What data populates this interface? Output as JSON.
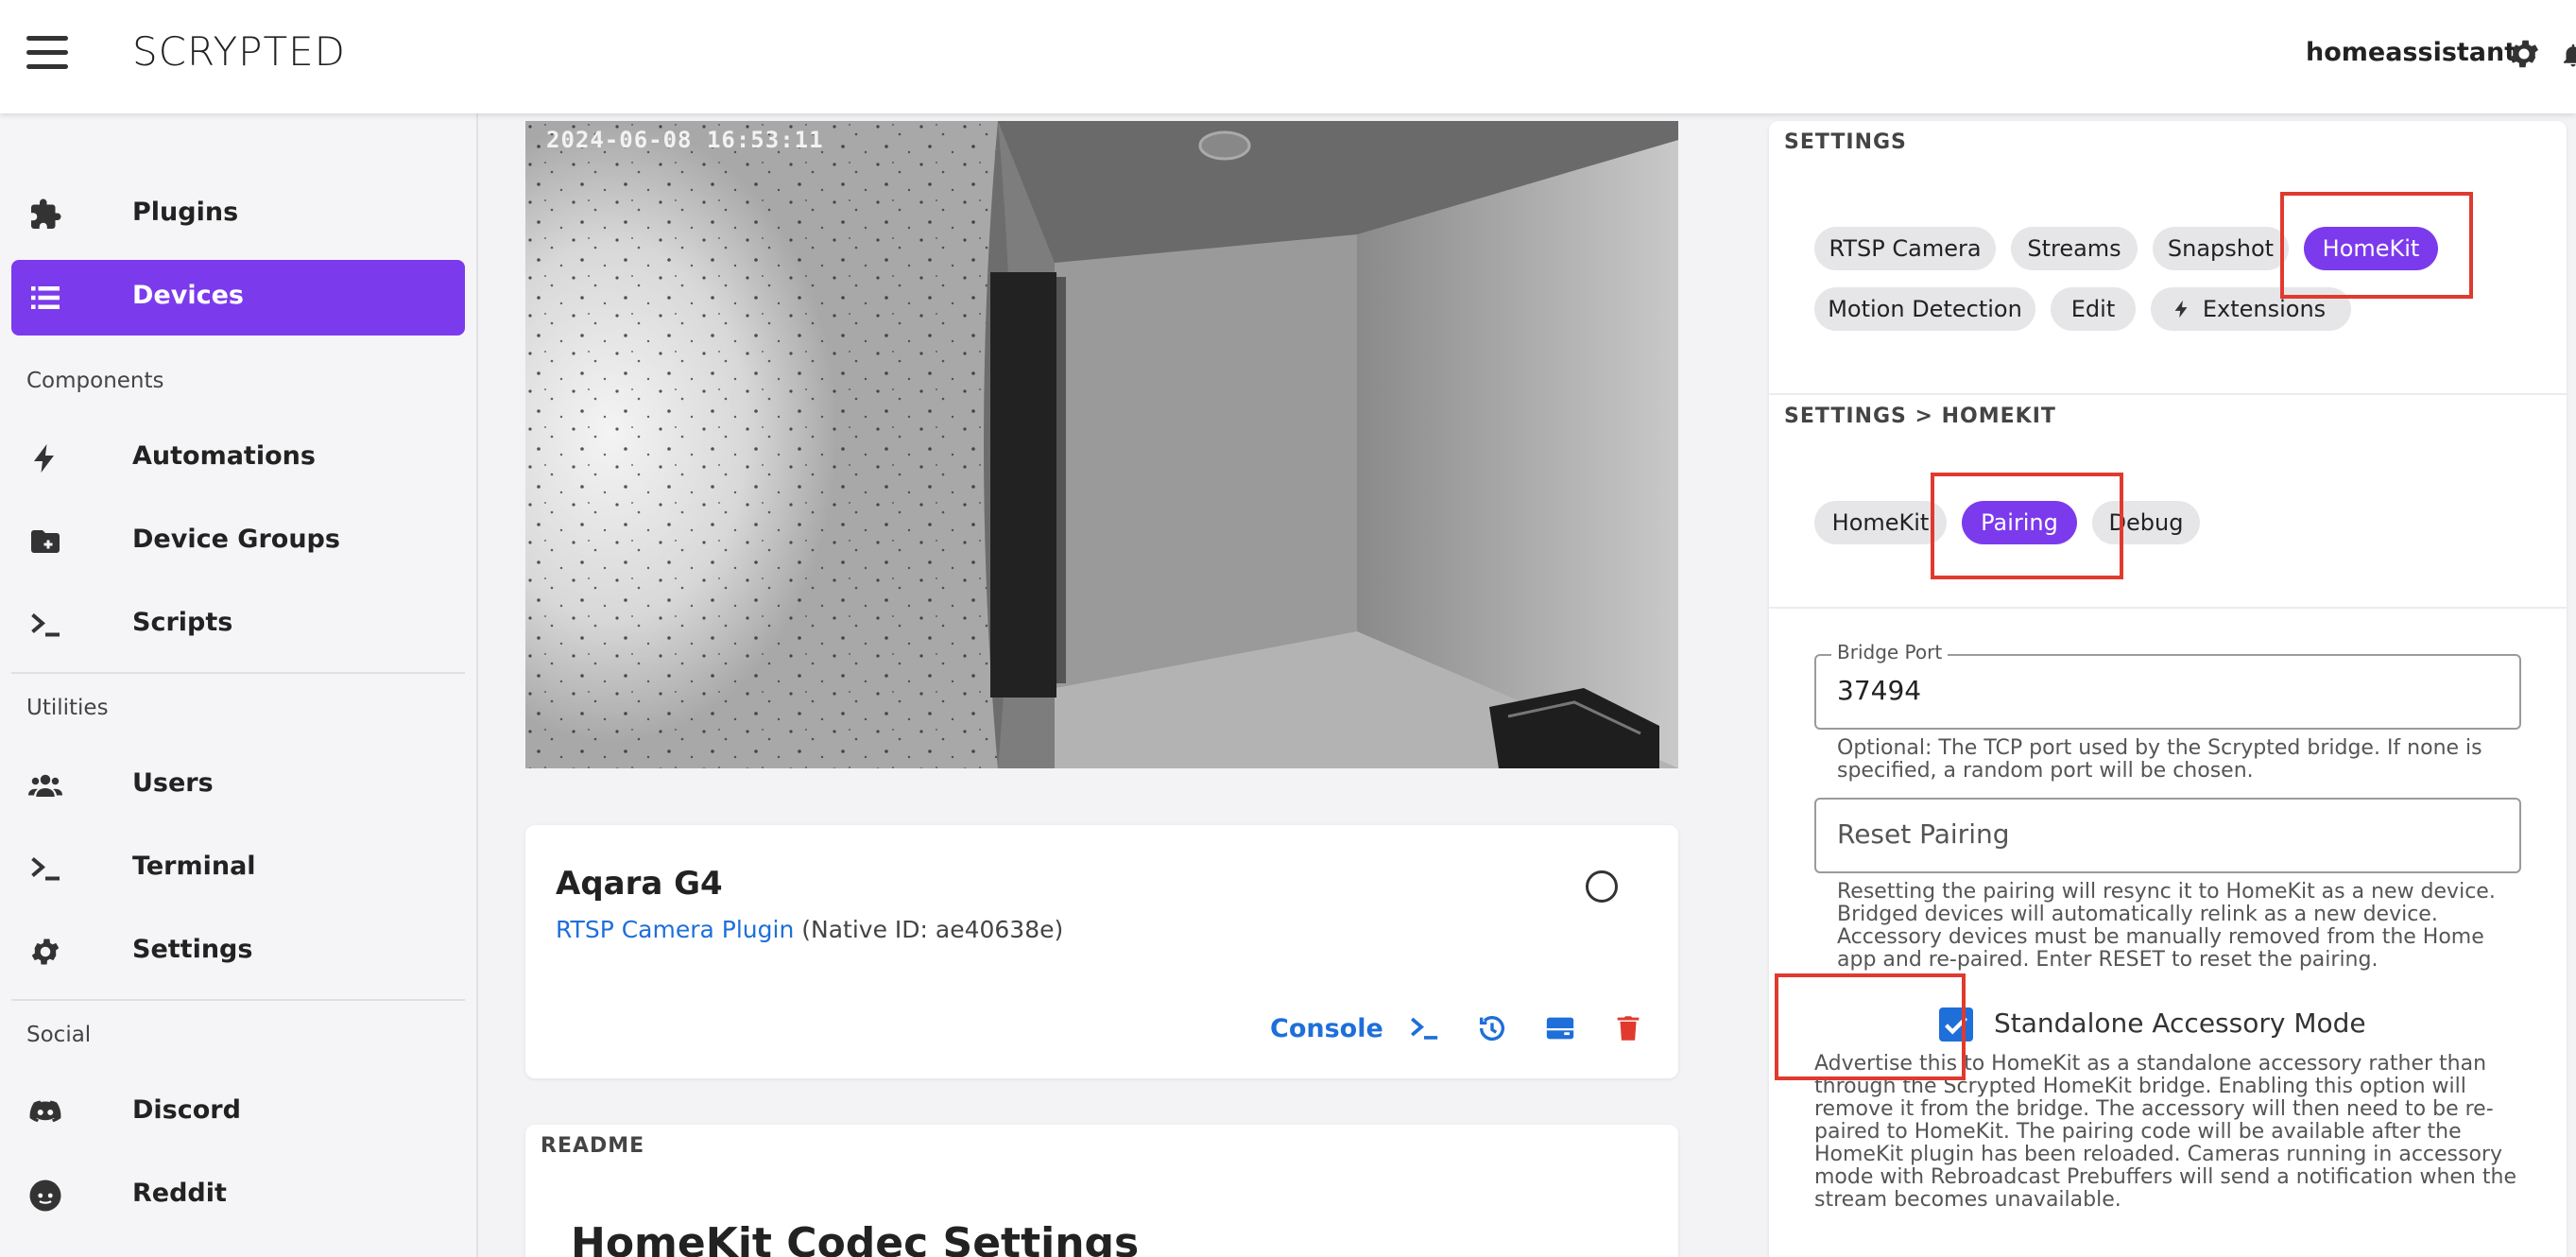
{
  "header": {
    "brand": "SCRYPTED",
    "user": "homeassistant",
    "icons": [
      "menu-icon",
      "gear-icon",
      "bell-icon"
    ]
  },
  "sidebar": {
    "items": [
      {
        "label": "Plugins",
        "icon": "puzzle-icon",
        "active": false
      },
      {
        "label": "Devices",
        "icon": "list-icon",
        "active": true
      }
    ],
    "sections": [
      {
        "title": "Components",
        "items": [
          {
            "label": "Automations",
            "icon": "bolt-icon"
          },
          {
            "label": "Device Groups",
            "icon": "folder-plus-icon"
          },
          {
            "label": "Scripts",
            "icon": "terminal-icon"
          }
        ]
      },
      {
        "title": "Utilities",
        "items": [
          {
            "label": "Users",
            "icon": "users-icon"
          },
          {
            "label": "Terminal",
            "icon": "terminal-icon"
          },
          {
            "label": "Settings",
            "icon": "gear-icon"
          }
        ]
      },
      {
        "title": "Social",
        "items": [
          {
            "label": "Discord",
            "icon": "discord-icon"
          },
          {
            "label": "Reddit",
            "icon": "reddit-icon"
          }
        ]
      }
    ],
    "active_color": "#7c3aed"
  },
  "video": {
    "timestamp": "2024-06-08 16:53:11"
  },
  "device": {
    "name": "Aqara G4",
    "plugin_link": "RTSP Camera Plugin",
    "native_id": "(Native ID: ae40638e)",
    "console_label": "Console",
    "action_icons": [
      "terminal-icon",
      "history-icon",
      "storage-icon",
      "trash-icon"
    ]
  },
  "readme": {
    "label": "README",
    "title": "HomeKit Codec Settings"
  },
  "settings": {
    "label": "SETTINGS",
    "tabs": [
      "RTSP Camera",
      "Streams",
      "Snapshot",
      "HomeKit",
      "Motion Detection",
      "Edit",
      "Extensions"
    ],
    "active_tab": "HomeKit",
    "sub_label": "SETTINGS > HOMEKIT",
    "sub_tabs": [
      "HomeKit",
      "Pairing",
      "Debug"
    ],
    "active_sub_tab": "Pairing",
    "bridge_port": {
      "legend": "Bridge Port",
      "value": "37494",
      "help": "Optional: The TCP port used by the Scrypted bridge. If none is specified, a random port will be chosen."
    },
    "reset_pairing": {
      "placeholder": "Reset Pairing",
      "help": "Resetting the pairing will resync it to HomeKit as a new device. Bridged devices will automatically relink as a new device. Accessory devices must be manually removed from the Home app and re-paired. Enter RESET to reset the pairing."
    },
    "standalone": {
      "label": "Standalone Accessory Mode",
      "checked": true,
      "help": "Advertise this to HomeKit as a standalone accessory rather than through the Scrypted HomeKit bridge. Enabling this option will remove it from the bridge. The accessory will then need to be re-paired to HomeKit. The pairing code will be available after the HomeKit plugin has been reloaded. Cameras running in accessory mode with Rebroadcast Prebuffers will send a notification when the stream becomes unavailable."
    }
  },
  "colors": {
    "accent": "#7c3aed",
    "link": "#1e6fd9",
    "danger": "#e03a2f",
    "highlight": "#e03a2f"
  }
}
